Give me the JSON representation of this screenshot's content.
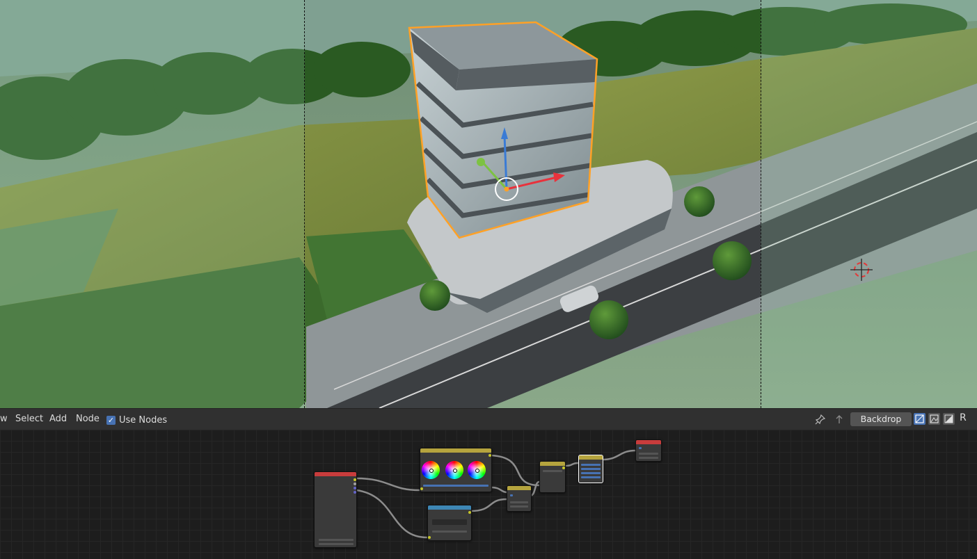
{
  "viewport": {
    "name": "3D Viewport - Camera view of building scene"
  },
  "node_editor": {
    "header": {
      "menu_partial": "w",
      "menu_select": "Select",
      "menu_add": "Add",
      "menu_node": "Node",
      "use_nodes_label": "Use Nodes",
      "use_nodes_checked": true,
      "backdrop_label": "Backdrop",
      "toggle_r_label": "R",
      "icons": [
        "pin-icon",
        "parent-icon",
        "backdrop-rgb-icon",
        "backdrop-alpha-icon",
        "backdrop-both-icon"
      ]
    },
    "nodes": [
      {
        "id": "render-layers",
        "color": "#c83c3c"
      },
      {
        "id": "color-balance",
        "color": "#b5a43e"
      },
      {
        "id": "rgb-curves",
        "color": "#3e87b5"
      },
      {
        "id": "alpha-over",
        "color": "#b5a43e"
      },
      {
        "id": "mix",
        "color": "#b5a43e"
      },
      {
        "id": "viewer",
        "color": "#b5a43e"
      },
      {
        "id": "composite",
        "color": "#c83c3c"
      }
    ]
  },
  "colors": {
    "accent": "#4772b3",
    "selection_outline": "#ffa126",
    "header_bg": "#303030",
    "canvas_bg": "#1d1d1d"
  }
}
